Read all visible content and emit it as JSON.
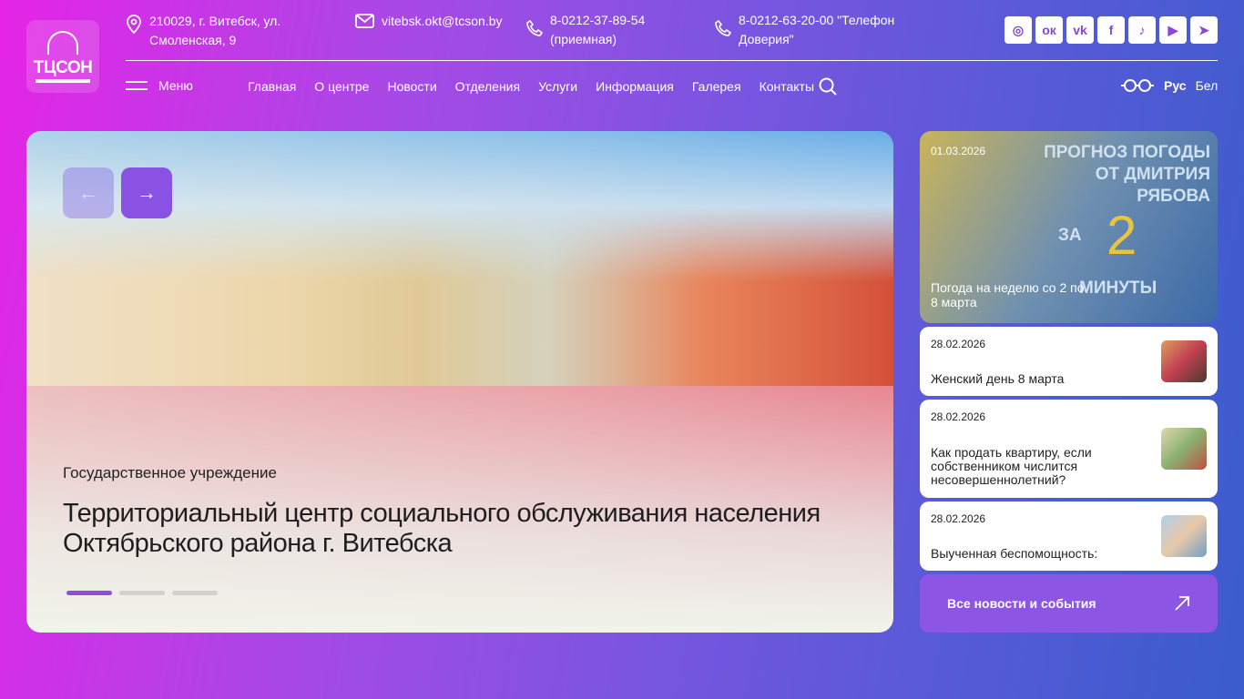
{
  "logo": {
    "text": "ТЦСОН"
  },
  "contacts": {
    "address": "210029, г. Витебск, ул. Смоленская, 9",
    "email": "vitebsk.okt@tcson.by",
    "phone1": "8-0212-37-89-54 (приемная)",
    "phone2": "8-0212-63-20-00 \"Телефон Доверия\""
  },
  "social": [
    {
      "icon": "instagram-icon",
      "glyph": "◎"
    },
    {
      "icon": "odnoklassniki-icon",
      "glyph": "ок"
    },
    {
      "icon": "vk-icon",
      "glyph": "vk"
    },
    {
      "icon": "facebook-icon",
      "glyph": "f"
    },
    {
      "icon": "tiktok-icon",
      "glyph": "♪"
    },
    {
      "icon": "youtube-icon",
      "glyph": "▶"
    },
    {
      "icon": "telegram-icon",
      "glyph": "➤"
    }
  ],
  "menu_label": "Меню",
  "nav": [
    "Главная",
    "О центре",
    "Новости",
    "Отделения",
    "Услуги",
    "Информация",
    "Галерея",
    "Контакты"
  ],
  "lang": {
    "ru": "Рус",
    "by": "Бел"
  },
  "hero": {
    "subtitle": "Государственное учреждение",
    "title": "Территориальный центр социального обслуживания населения Октябрьского района г. Витебска",
    "slide": 1,
    "slides": 3
  },
  "featured": {
    "date": "01.03.2026",
    "image_text": "ПРОГНОЗ ПОГОДЫ ОТ ДМИТРИЯ РЯБОВА",
    "image_za": "ЗА",
    "image_num": "2",
    "image_min": "МИНУТЫ",
    "caption": "Погода на неделю со 2 по 8 марта"
  },
  "news": [
    {
      "date": "28.02.2026",
      "title": "Женский день 8 марта"
    },
    {
      "date": "28.02.2026",
      "title": "Как продать квартиру, если собственником числится несовершеннолетний?"
    },
    {
      "date": "28.02.2026",
      "title": "Выученная беспомощность:"
    }
  ],
  "all_news": "Все новости и события"
}
